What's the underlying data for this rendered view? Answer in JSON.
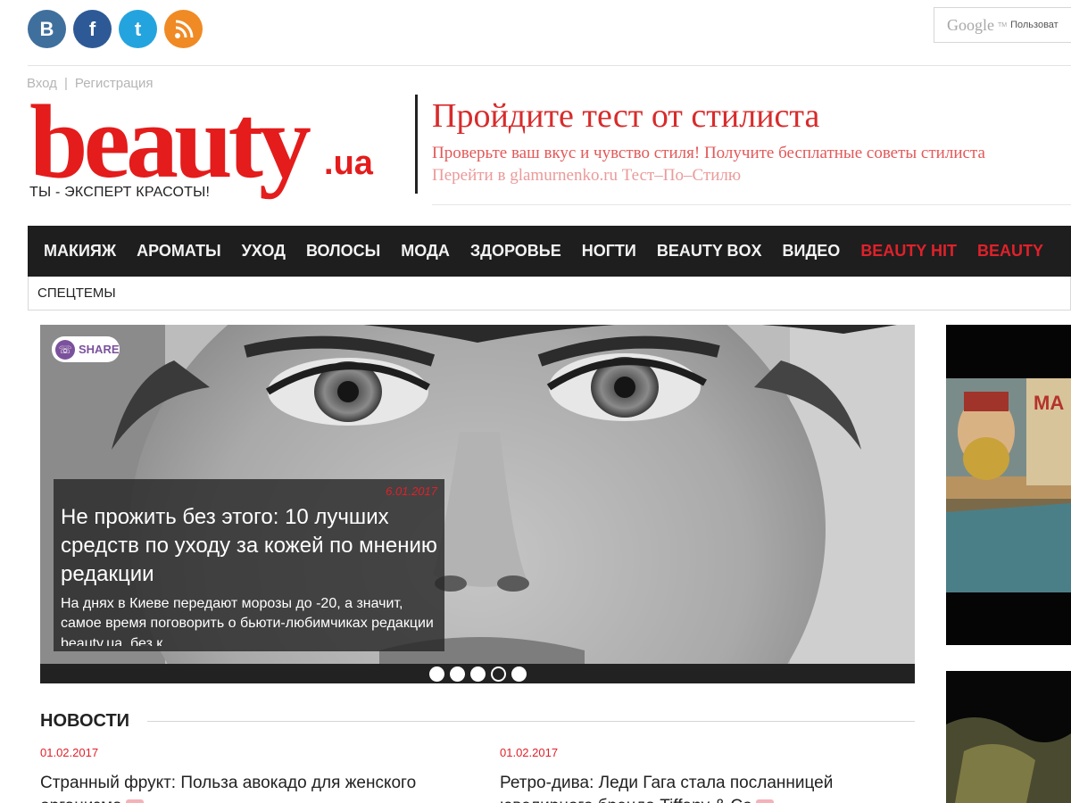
{
  "social": {
    "vk_label": "В",
    "facebook_label": "f",
    "twitter_label": "t",
    "rss_label": "))"
  },
  "search": {
    "google_label": "Google",
    "tm": "TM",
    "placeholder": "Пользоват"
  },
  "auth": {
    "login": "Вход",
    "separator": "|",
    "register": "Регистрация"
  },
  "logo": {
    "word": "beauty",
    "dot": ".",
    "ua": "ua",
    "slogan": "ТЫ - ЭКСПЕРТ КРАСОТЫ!"
  },
  "promo": {
    "title": "Пройдите тест от стилиста",
    "description": "Проверьте ваш вкус и чувство стиля! Получите бесплатные советы стилиста",
    "link": "Перейти в glamurnenko.ru Тест–По–Стилю"
  },
  "nav": {
    "items": [
      {
        "label": "МАКИЯЖ",
        "red": false
      },
      {
        "label": "АРОМАТЫ",
        "red": false
      },
      {
        "label": "УХОД",
        "red": false
      },
      {
        "label": "ВОЛОСЫ",
        "red": false
      },
      {
        "label": "МОДА",
        "red": false
      },
      {
        "label": "ЗДОРОВЬЕ",
        "red": false
      },
      {
        "label": "НОГТИ",
        "red": false
      },
      {
        "label": "BEAUTY BOX",
        "red": false
      },
      {
        "label": "ВИДЕО",
        "red": false
      },
      {
        "label": "BEAUTY HIT",
        "red": true
      },
      {
        "label": "BEAUTY",
        "red": true
      }
    ],
    "sub": "СПЕЦТЕМЫ"
  },
  "hero": {
    "share_label": "SHARE",
    "date": "6.01.2017",
    "title": "Не прожить без этого: 10 лучших средств по уходу за кожей по мнению редакции",
    "description": "На днях в Киеве передают морозы до -20, а значит, самое время поговорить о бьюти-любимчиках редакции beauty.ua, без к...",
    "slides": 5,
    "active_slide": 4
  },
  "news": {
    "heading": "НОВОСТИ",
    "items": [
      {
        "date": "01.02.2017",
        "title": "Странный фрукт: Польза авокадо для женского организма"
      },
      {
        "date": "01.02.2017",
        "title": "Ретро-дива: Леди Гага стала посланницей ювелирного бренда Tiffany & Co"
      }
    ]
  },
  "colors": {
    "brand_red": "#e41c1c",
    "nav_bg": "#1e1e1e"
  }
}
